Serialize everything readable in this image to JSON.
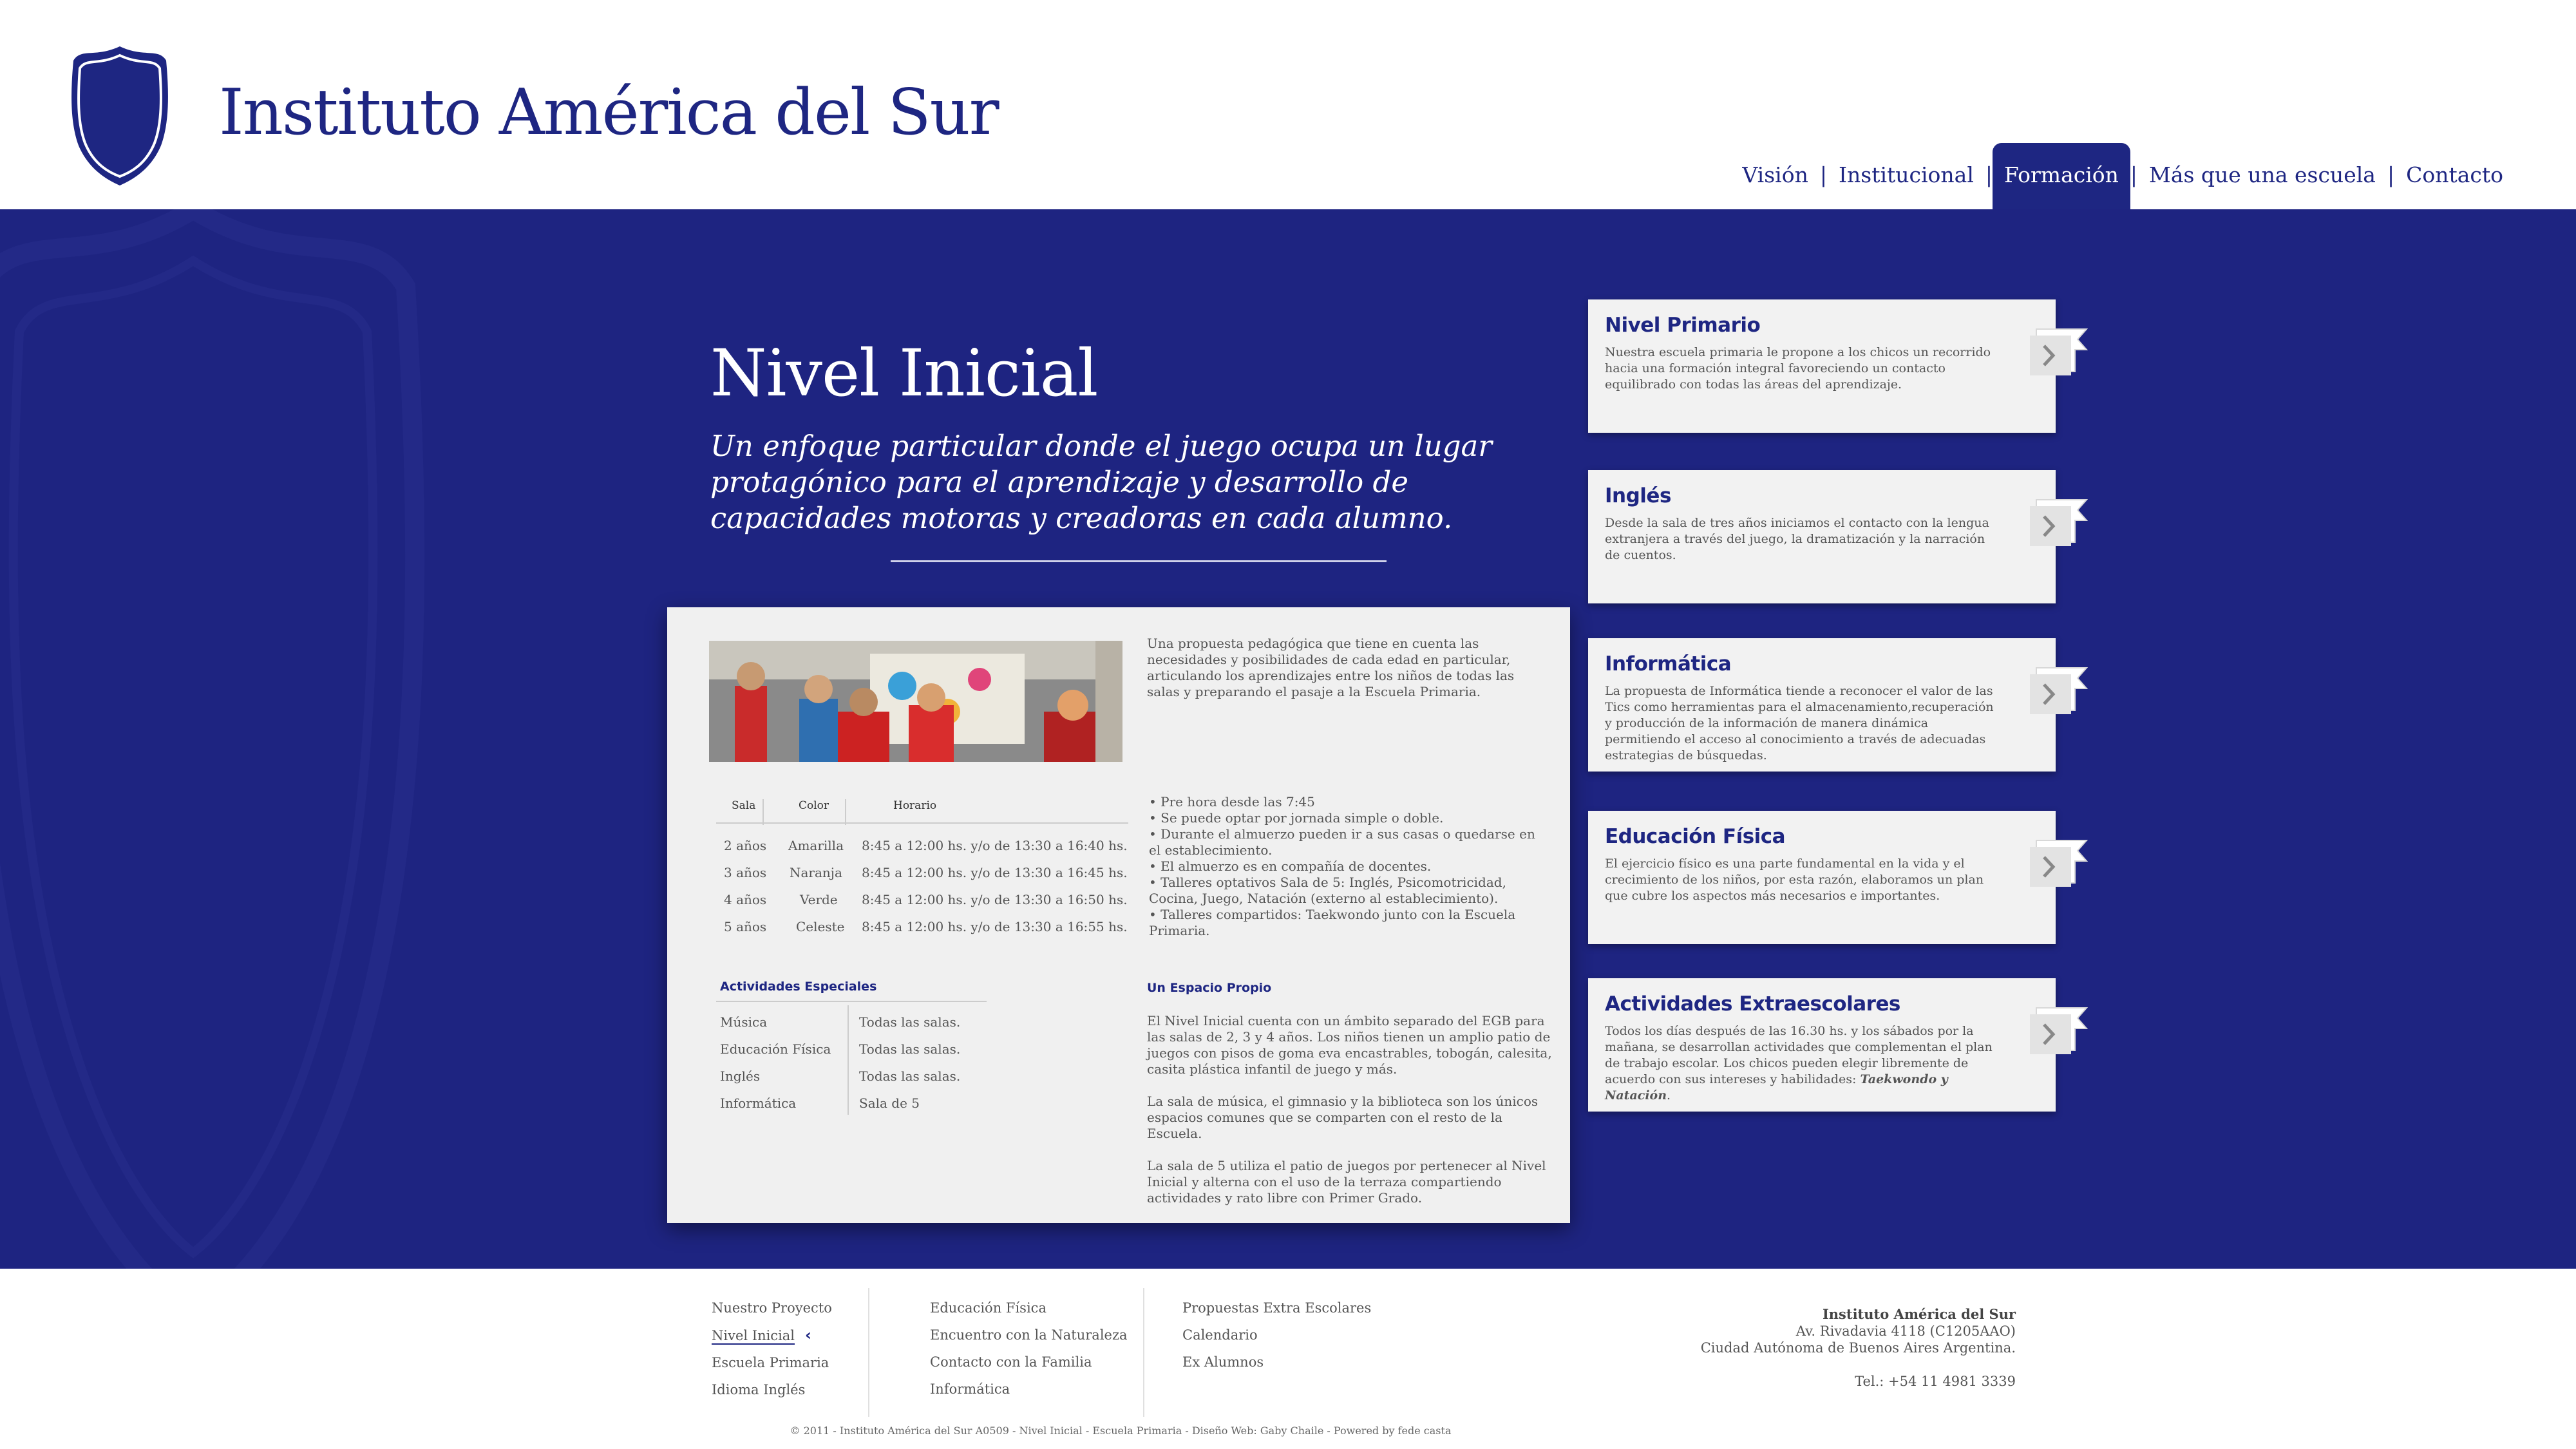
{
  "header": {
    "site_title": "Instituto América del Sur",
    "logo_icon": "shield-logo-icon",
    "nav": [
      {
        "label": "Visión"
      },
      {
        "label": "Institucional"
      },
      {
        "label": "Formación",
        "active": true
      },
      {
        "label": "Más que una escuela"
      },
      {
        "label": "Contacto"
      }
    ]
  },
  "main": {
    "heading": "Nivel Inicial",
    "subtitle": "Un enfoque particular donde el juego ocupa un lugar protagónico para el aprendizaje y desarrollo de capacidades motoras y creadoras en cada alumno.",
    "intro": "Una propuesta pedagógica que tiene en cuenta las necesidades y posibilidades de cada edad en particular, articulando los aprendizajes entre los niños de todas las salas y preparando el pasaje a la Escuela Primaria.",
    "schedule": {
      "headers": [
        "Sala",
        "Color",
        "Horario"
      ],
      "rows": [
        [
          "2 años",
          "Amarilla",
          "8:45 a 12:00 hs. y/o de 13:30 a 16:40 hs."
        ],
        [
          "3 años",
          "Naranja",
          "8:45 a 12:00 hs. y/o de 13:30 a 16:45 hs."
        ],
        [
          "4 años",
          "Verde",
          "8:45 a 12:00 hs. y/o de 13:30 a 16:50 hs."
        ],
        [
          "5 años",
          "Celeste",
          "8:45 a 12:00 hs. y/o de 13:30 a 16:55 hs."
        ]
      ]
    },
    "bullets": [
      "Pre hora desde las 7:45",
      "Se puede optar por jornada simple o doble.",
      "Durante el almuerzo pueden ir a sus casas o quedarse en el establecimiento.",
      "El almuerzo es en compañía de docentes.",
      "Talleres optativos Sala de 5: Inglés, Psicomotricidad, Cocina, Juego, Natación (externo al establecimiento).",
      "Talleres compartidos: Taekwondo junto con la Escuela Primaria."
    ],
    "activities": {
      "title": "Actividades Especiales",
      "rows": [
        [
          "Música",
          "Todas las salas."
        ],
        [
          "Educación Física",
          "Todas las salas."
        ],
        [
          "Inglés",
          "Todas las salas."
        ],
        [
          "Informática",
          "Sala de 5"
        ]
      ]
    },
    "espacio": {
      "title": "Un Espacio Propio",
      "paragraphs": [
        "El Nivel Inicial cuenta con un ámbito separado del EGB para las salas de 2, 3 y 4 años. Los niños tienen un amplio patio de juegos con pisos de goma eva encastrables, tobogán, calesita, casita plástica infantil de juego y más.",
        "La sala de música, el gimnasio y la biblioteca son los únicos espacios comunes que se comparten con el resto de la Escuela.",
        "La sala de 5 utiliza el patio de juegos por pertenecer al Nivel Inicial y alterna con el uso de la terraza compartiendo actividades y rato libre con Primer Grado."
      ]
    }
  },
  "cards": [
    {
      "title": "Nivel Primario",
      "text": "Nuestra escuela primaria le propone a los chicos un recorrido hacia una formación integral favoreciendo un contacto equilibrado con todas las áreas del aprendizaje."
    },
    {
      "title": "Inglés",
      "text": "Desde la sala de tres años iniciamos el contacto con la lengua extranjera a través del juego, la dramatización y la narración de cuentos."
    },
    {
      "title": "Informática",
      "text": "La propuesta de Informática tiende a reconocer el valor de las Tics como herramientas para el almacenamiento,recuperación y producción de la información de manera dinámica permitiendo el acceso al conocimiento a través de adecuadas estrategias de búsquedas."
    },
    {
      "title": "Educación Física",
      "text": "El ejercicio físico es una parte fundamental en la vida y el crecimiento de los niños, por esta razón, elaboramos un plan que cubre los aspectos más necesarios e importantes."
    },
    {
      "title": "Actividades Extraescolares",
      "text": "Todos los días después de las 16.30 hs. y los sábados por la mañana, se desarrollan actividades que complementan el plan de trabajo escolar. Los chicos pueden elegir libremente de acuerdo con sus intereses y habilidades:",
      "emphasis": "Taekwondo y Natación",
      "tail": "."
    }
  ],
  "footer": {
    "col1": [
      "Nuestro Proyecto",
      "Nivel Inicial",
      "Escuela Primaria",
      "Idioma Inglés"
    ],
    "col2": [
      "Educación Física",
      "Encuentro con la Naturaleza",
      "Contacto con la Familia",
      "Informática"
    ],
    "col3": [
      "Propuestas Extra Escolares",
      "Calendario",
      "Ex Alumnos"
    ],
    "address": {
      "name": "Instituto América del Sur",
      "street": "Av. Rivadavia 4118 (C1205AAO)",
      "city": "Ciudad Autónoma de Buenos Aires Argentina.",
      "tel": "Tel.: +54 11 4981 3339"
    },
    "copyright": "© 2011 - Instituto América del Sur A0509 - Nivel Inicial - Escuela Primaria - Diseño Web: Gaby Chaile  - Powered by fede casta"
  },
  "colors": {
    "brand": "#1e2682",
    "band": "#1e2481",
    "card": "#f2f2f2"
  }
}
